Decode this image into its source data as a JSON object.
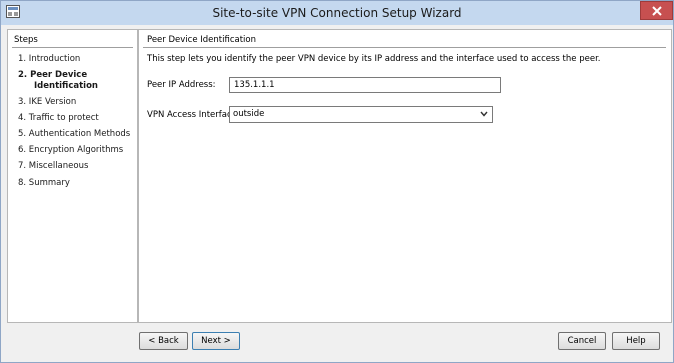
{
  "window": {
    "title": "Site-to-site VPN Connection Setup Wizard"
  },
  "steps": {
    "header": "Steps",
    "items": [
      {
        "label": "1.  Introduction",
        "active": false
      },
      {
        "label": "2.  Peer Device",
        "label2": "Identification",
        "active": true
      },
      {
        "label": "3.  IKE Version",
        "active": false
      },
      {
        "label": "4.  Traffic to protect",
        "active": false
      },
      {
        "label": "5.  Authentication Methods",
        "active": false
      },
      {
        "label": "6.  Encryption Algorithms",
        "active": false
      },
      {
        "label": "7.  Miscellaneous",
        "active": false
      },
      {
        "label": "8.  Summary",
        "active": false
      }
    ]
  },
  "content": {
    "section_title": "Peer Device Identification",
    "description": "This step lets you identify the peer VPN device by its IP address and the interface used to access the peer.",
    "peer_ip": {
      "label": "Peer IP Address:",
      "value": "135.1.1.1"
    },
    "interface": {
      "label": "VPN Access Interface:",
      "value": "outside"
    }
  },
  "buttons": {
    "back": "< Back",
    "next": "Next >",
    "cancel": "Cancel",
    "help": "Help"
  },
  "icons": {
    "app": "vpn-wizard-icon",
    "close": "close-icon",
    "dropdown": "chevron-down-icon"
  },
  "colors": {
    "titlebar": "#c4d8ef",
    "close_button": "#c75050"
  }
}
